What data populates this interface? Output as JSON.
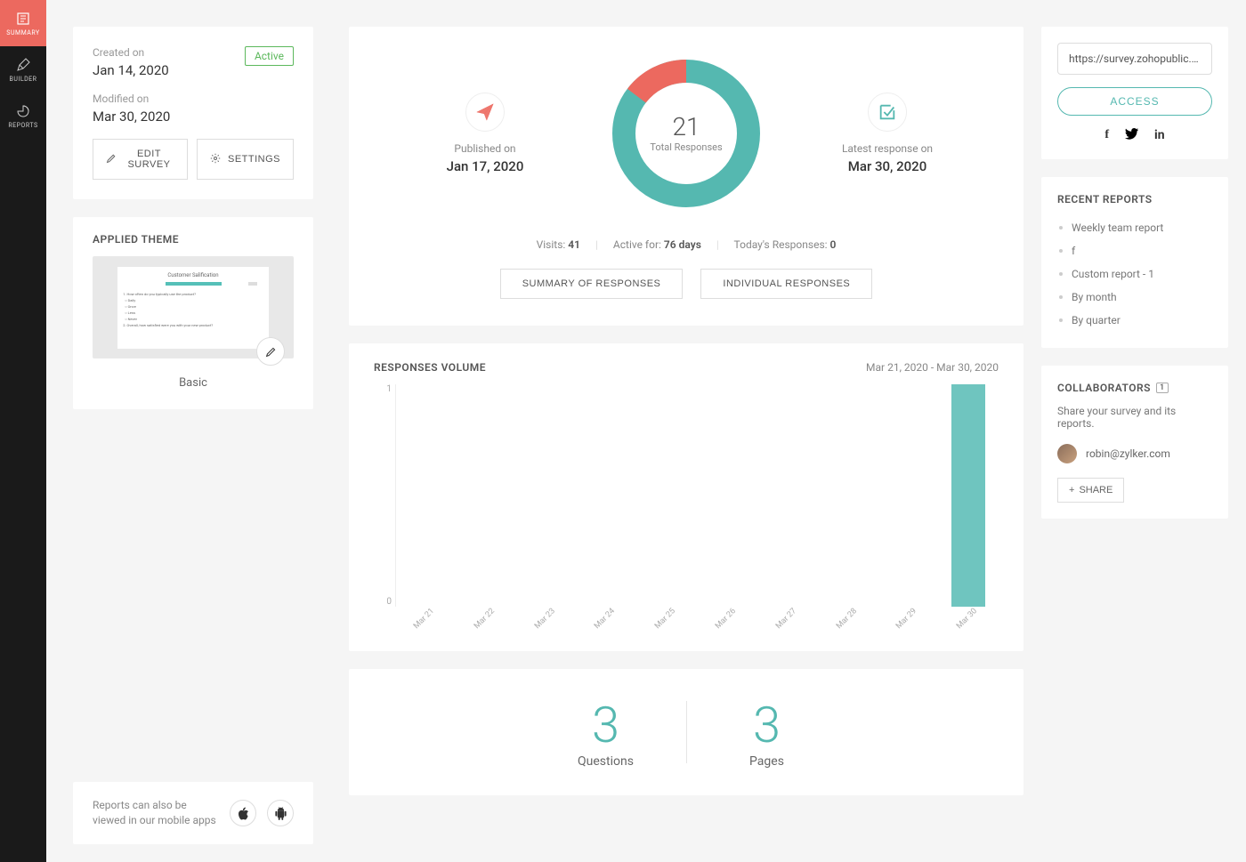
{
  "sidenav": [
    {
      "id": "summary",
      "label": "SUMMARY",
      "active": true
    },
    {
      "id": "builder",
      "label": "BUILDER",
      "active": false
    },
    {
      "id": "reports",
      "label": "REPORTS",
      "active": false
    }
  ],
  "info": {
    "created_label": "Created on",
    "created_value": "Jan 14, 2020",
    "modified_label": "Modified on",
    "modified_value": "Mar 30, 2020",
    "status": "Active",
    "edit_btn": "EDIT SURVEY",
    "settings_btn": "SETTINGS"
  },
  "theme": {
    "title": "APPLIED THEME",
    "preview_title": "Customer Salification",
    "name": "Basic"
  },
  "mobile_note": "Reports can also be viewed in our mobile apps",
  "hero": {
    "published_label": "Published on",
    "published_value": "Jan 17, 2020",
    "latest_label": "Latest response on",
    "latest_value": "Mar 30, 2020",
    "total_num": "21",
    "total_label": "Total Responses",
    "visits_label": "Visits:",
    "visits_value": "41",
    "active_label": "Active for:",
    "active_value": "76 days",
    "today_label": "Today's Responses:",
    "today_value": "0",
    "summary_btn": "SUMMARY OF RESPONSES",
    "individual_btn": "INDIVIDUAL RESPONSES"
  },
  "volume": {
    "title": "RESPONSES VOLUME",
    "range": "Mar 21, 2020 - Mar 30, 2020"
  },
  "chart_data": {
    "type": "bar",
    "categories": [
      "Mar 21",
      "Mar 22",
      "Mar 23",
      "Mar 24",
      "Mar 25",
      "Mar 26",
      "Mar 27",
      "Mar 28",
      "Mar 29",
      "Mar 30"
    ],
    "values": [
      0,
      0,
      0,
      0,
      0,
      0,
      0,
      0,
      0,
      1
    ],
    "title": "RESPONSES VOLUME",
    "xlabel": "",
    "ylabel": "",
    "ylim": [
      0,
      1
    ]
  },
  "qp": {
    "questions_num": "3",
    "questions_label": "Questions",
    "pages_num": "3",
    "pages_label": "Pages"
  },
  "access": {
    "url": "https://survey.zohopublic.co...",
    "btn": "ACCESS"
  },
  "recent_reports": {
    "title": "RECENT REPORTS",
    "items": [
      "Weekly team report",
      "f",
      "Custom report - 1",
      "By month",
      "By quarter"
    ]
  },
  "collaborators": {
    "title": "COLLABORATORS",
    "count": "1",
    "subtitle": "Share your survey and its reports.",
    "user": "robin@zylker.com",
    "share_btn": "SHARE"
  }
}
